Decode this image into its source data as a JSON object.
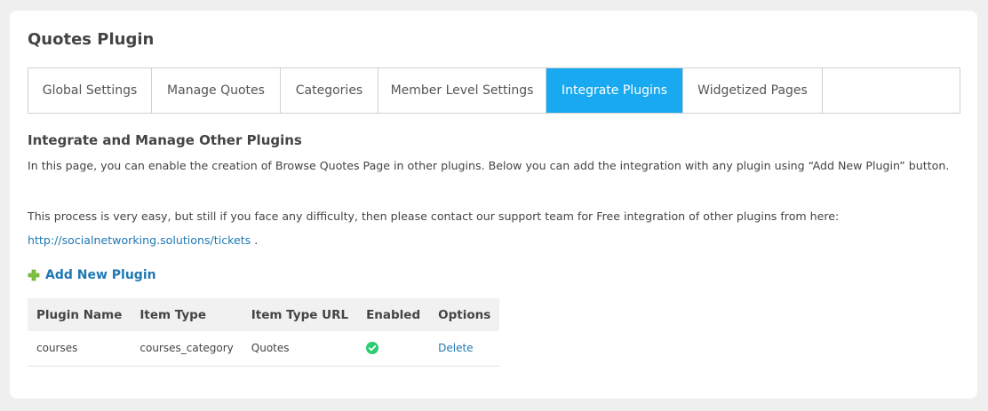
{
  "page": {
    "title": "Quotes Plugin"
  },
  "tabs": [
    {
      "label": "Global Settings",
      "active": false
    },
    {
      "label": "Manage Quotes",
      "active": false
    },
    {
      "label": "Categories",
      "active": false
    },
    {
      "label": "Member Level Settings",
      "active": false
    },
    {
      "label": "Integrate Plugins",
      "active": true
    },
    {
      "label": "Widgetized Pages",
      "active": false
    }
  ],
  "section": {
    "heading": "Integrate and Manage Other Plugins",
    "description": "In this page, you can enable the creation of Browse Quotes Page in other plugins. Below you can add the integration with any plugin using “Add New Plugin” button.",
    "support_text": "This process is very easy, but still if you face any difficulty, then please contact our support team for Free integration of other plugins from here:",
    "support_link": "http://socialnetworking.solutions/tickets",
    "support_link_suffix": " ."
  },
  "add_button": {
    "label": "Add New Plugin",
    "icon": "plus-icon"
  },
  "table": {
    "headers": [
      "Plugin Name",
      "Item Type",
      "Item Type URL",
      "Enabled",
      "Options"
    ],
    "rows": [
      {
        "plugin_name": "courses",
        "item_type": "courses_category",
        "item_type_url": "Quotes",
        "enabled_icon": "check-circle-icon",
        "option": "Delete"
      }
    ]
  },
  "colors": {
    "active_tab": "#18a9f0",
    "link": "#1f78b4",
    "enabled_check": "#2ecc71",
    "add_icon": "#7ec242"
  }
}
